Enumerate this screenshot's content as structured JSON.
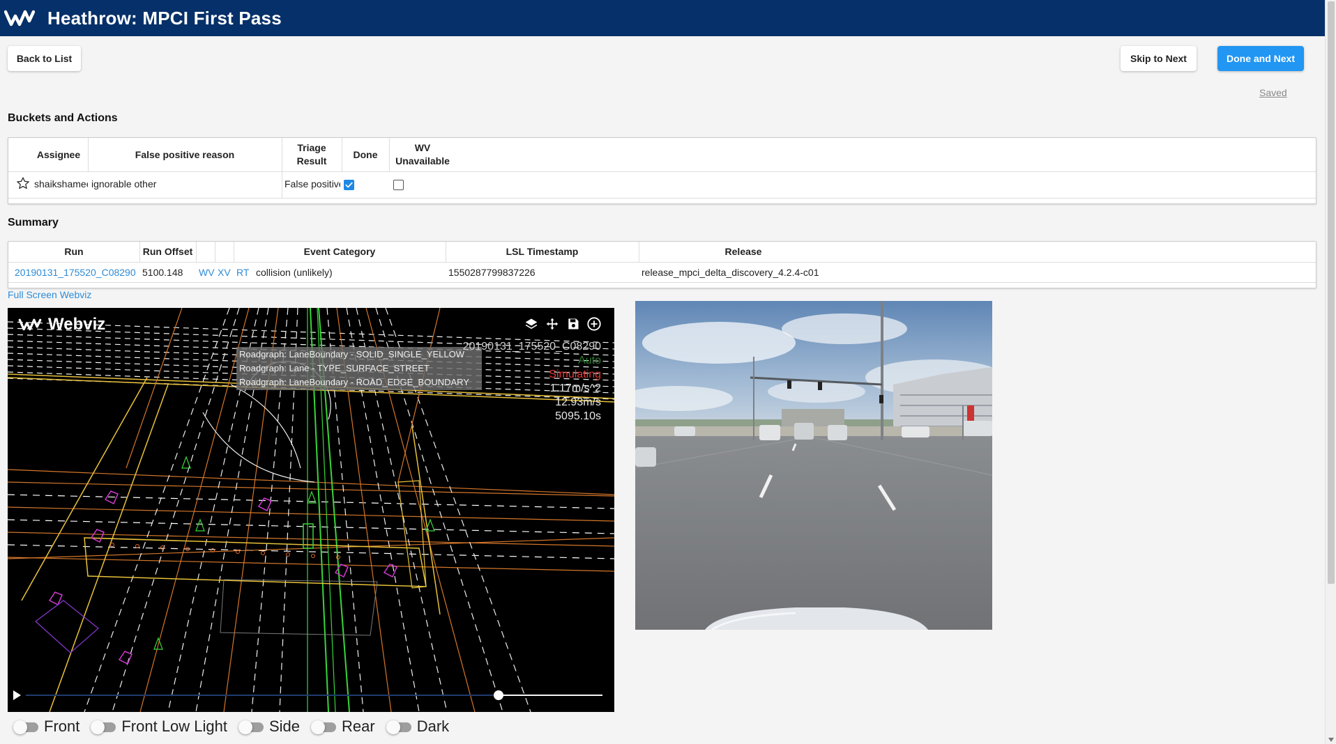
{
  "app": {
    "title": "Heathrow: MPCI First Pass"
  },
  "nav": {
    "back_label": "Back to List",
    "skip_label": "Skip to Next",
    "done_label": "Done and Next",
    "saved_label": "Saved"
  },
  "buckets": {
    "title": "Buckets and Actions",
    "headers": {
      "assignee": "Assignee",
      "reason": "False positive reason",
      "triage": "Triage Result",
      "done": "Done",
      "wv": "WV Unavailable"
    },
    "row": {
      "assignee": "shaikshameer",
      "reason": "ignorable other",
      "triage": "False positive",
      "done": true,
      "wv_unavailable": false
    }
  },
  "summary": {
    "title": "Summary",
    "headers": {
      "run": "Run",
      "offset": "Run Offset",
      "event": "Event Category",
      "timestamp": "LSL Timestamp",
      "release": "Release"
    },
    "row": {
      "run": "20190131_175520_C08290",
      "offset": "5100.148",
      "link_wv": "WV",
      "link_xv": "XV",
      "link_rt": "RT",
      "event": "collision (unlikely)",
      "timestamp": "1550287799837226",
      "release": "release_mpci_delta_discovery_4.2.4-c01"
    }
  },
  "webviz": {
    "fullscreen_label": "Full Screen Webviz",
    "brand": "Webviz",
    "tools": [
      "layers-icon",
      "move-icon",
      "save-icon",
      "add-circle-icon"
    ],
    "tooltip": [
      "Roadgraph: LaneBoundary - SOLID_SINGLE_YELLOW",
      "Roadgraph: Lane - TYPE_SURFACE_STREET",
      "Roadgraph: LaneBoundary - ROAD_EDGE_BOUNDARY"
    ],
    "hud": {
      "run_id": "20190131_175520_C08290",
      "mode": "Auto",
      "status": "Simulating",
      "accel": "1.17m/s^2",
      "speed": "12.93m/s",
      "time": "5095.10s"
    },
    "playback_progress": 0.82
  },
  "camera_toggles": [
    {
      "label": "Front",
      "on": false
    },
    {
      "label": "Front Low Light",
      "on": false
    },
    {
      "label": "Side",
      "on": false
    },
    {
      "label": "Rear",
      "on": false
    },
    {
      "label": "Dark",
      "on": false
    }
  ],
  "colors": {
    "header_bg": "#063069",
    "primary": "#2196f3",
    "link": "#2e8bd6",
    "status_red": "#e53935",
    "mode_green": "#2e7d32"
  }
}
